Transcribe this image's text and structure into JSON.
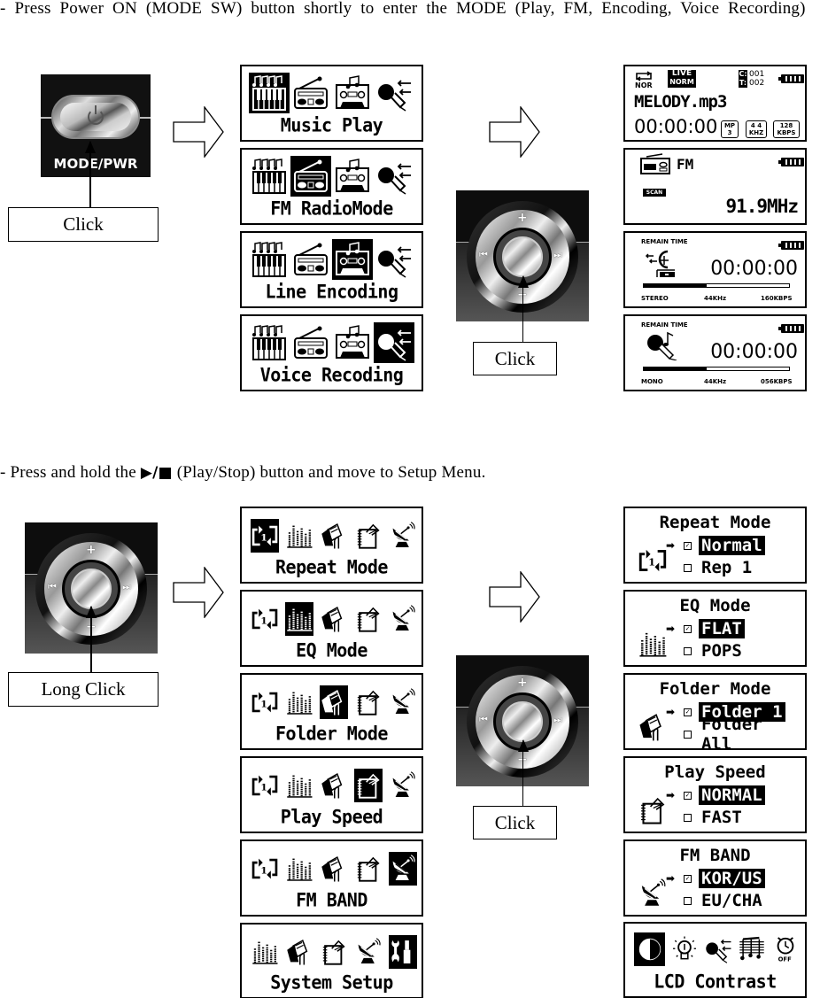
{
  "section1": {
    "instruction": "- Press Power ON (MODE SW) button shortly to enter the MODE (Play, FM, Encoding, Voice Recording)",
    "power_button": {
      "label": "MODE/PWR",
      "icon": "power-icon"
    },
    "callout_power": "Click",
    "callout_wheel": "Click",
    "mode_menu": [
      {
        "label": "Music Play",
        "selected_index": 0
      },
      {
        "label": "FM RadioMode",
        "selected_index": 1
      },
      {
        "label": "Line Encoding",
        "selected_index": 2
      },
      {
        "label": "Voice Recoding",
        "selected_index": 3
      }
    ],
    "mode_icons": [
      "piano-icon",
      "radio-icon",
      "cassette-icon",
      "microphone-icon"
    ],
    "music_screen": {
      "repeat_label": "NOR",
      "eq_badge_top": "LIVE",
      "eq_badge_bottom": "NORM",
      "c_label": "C:",
      "t_label": "T:",
      "c_value": "001",
      "t_value": "002",
      "filename": "MELODY.mp3",
      "time": "00:00:00",
      "format_top": "MP",
      "format_bottom": "3",
      "rate_top": "4 4",
      "rate_bottom": "KHZ",
      "bitrate_top": "128",
      "bitrate_bottom": "KBPS"
    },
    "fm_screen": {
      "label": "FM",
      "scan_badge": "SCAN",
      "frequency": "91.9MHz"
    },
    "encoding_screen": {
      "remain_label": "REMAIN TIME",
      "time": "00:00:00",
      "progress": 0.43,
      "channel": "STEREO",
      "sample_rate": "44KHz",
      "bitrate": "160KBPS"
    },
    "voice_screen": {
      "remain_label": "REMAIN TIME",
      "time": "00:00:00",
      "progress": 0.43,
      "channel": "MONO",
      "sample_rate": "44KHz",
      "bitrate": "056KBPS"
    }
  },
  "section2": {
    "instruction_prefix": "- Press and hold the ",
    "instruction_symbol": "▶/■",
    "instruction_suffix": " (Play/Stop) button and move to Setup Menu.",
    "callout_long": "Long Click",
    "callout_click": "Click",
    "setup_menu": [
      {
        "label": "Repeat Mode",
        "selected_index": 0
      },
      {
        "label": "EQ Mode",
        "selected_index": 1
      },
      {
        "label": "Folder Mode",
        "selected_index": 2
      },
      {
        "label": "Play Speed",
        "selected_index": 3
      },
      {
        "label": "FM BAND",
        "selected_index": 4
      },
      {
        "label": "System Setup",
        "selected_index": 4
      }
    ],
    "setup_icons": [
      "repeat-icon",
      "equalizer-icon",
      "folder-icon",
      "notebook-icon",
      "satellite-dish-icon"
    ],
    "system_icons": [
      "equalizer-icon",
      "folder-icon",
      "notebook-icon",
      "satellite-dish-icon",
      "tools-icon"
    ],
    "option_screens": [
      {
        "title": "Repeat Mode",
        "icon": "repeat-icon",
        "options": [
          {
            "label": "Normal",
            "checked": true
          },
          {
            "label": "Rep 1",
            "checked": false
          }
        ]
      },
      {
        "title": "EQ Mode",
        "icon": "equalizer-icon",
        "options": [
          {
            "label": "FLAT",
            "checked": true
          },
          {
            "label": "POPS",
            "checked": false
          }
        ]
      },
      {
        "title": "Folder Mode",
        "icon": "folder-icon",
        "options": [
          {
            "label": "Folder 1",
            "checked": true
          },
          {
            "label": "Folder All",
            "checked": false
          }
        ]
      },
      {
        "title": "Play Speed",
        "icon": "notebook-icon",
        "options": [
          {
            "label": "NORMAL",
            "checked": true
          },
          {
            "label": "FAST",
            "checked": false
          }
        ]
      },
      {
        "title": "FM BAND",
        "icon": "satellite-dish-icon",
        "options": [
          {
            "label": "KOR/US",
            "checked": true
          },
          {
            "label": "EU/CHA",
            "checked": false
          }
        ]
      }
    ],
    "lcd_contrast": {
      "label": "LCD Contrast",
      "icons": [
        "contrast-icon",
        "backlight-bulb-icon",
        "microphone-icon",
        "music-score-icon",
        "auto-off-timer-icon"
      ],
      "selected_index": 0,
      "timer_label": "OFF"
    }
  }
}
